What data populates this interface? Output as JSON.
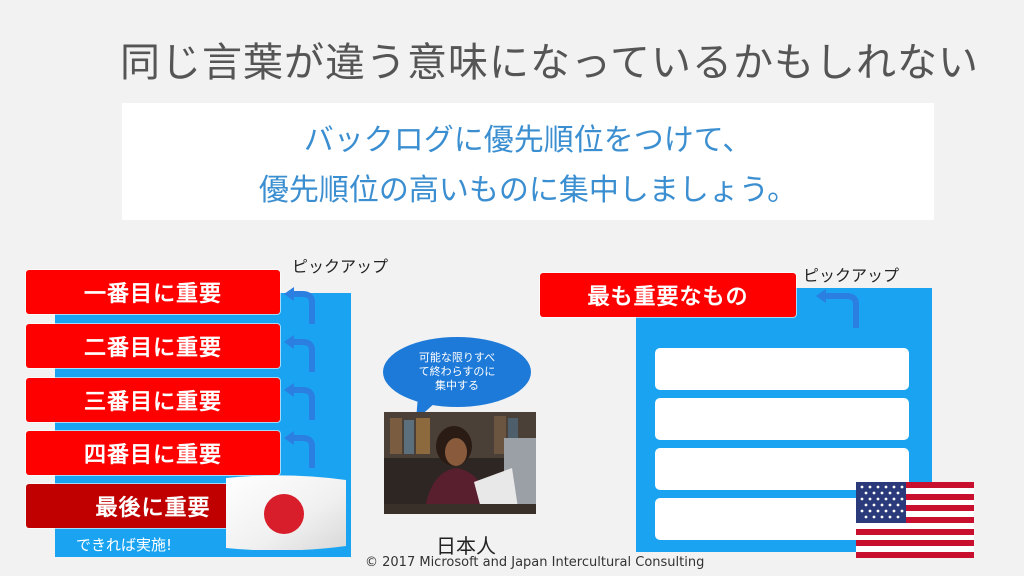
{
  "slide": {
    "title": "同じ言葉が違う意味になっているかもしれない",
    "banner": {
      "line1": "バックログに優先順位をつけて、",
      "line2": "優先順位の高いものに集中しましょう。"
    },
    "left": {
      "pickup": "ピックアップ",
      "bars": [
        "一番目に重要",
        "二番目に重要",
        "三番目に重要",
        "四番目に重要",
        "最後に重要"
      ],
      "note": "できれば実施!"
    },
    "middle": {
      "bubble_lines": [
        "可能な限りすべ",
        "て終わらすのに",
        "集中する"
      ],
      "caption": "日本人"
    },
    "right": {
      "pickup": "ピックアップ",
      "bar": "最も重要なもの",
      "row_count": 4
    },
    "footer": {
      "copyright": "© 2017 Microsoft and Japan Intercultural Consulting"
    },
    "colors": {
      "red": "#ff0000",
      "dark_red": "#c00000",
      "blue_panel": "#1aa3f0",
      "arrow_blue": "#2b7fe0",
      "banner_text": "#3b8fd1"
    },
    "icons": {
      "japan_flag": "japan-flag-icon",
      "usa_flag": "usa-flag-icon",
      "speech_bubble": "speech-bubble-icon",
      "photo": "tired-person-photo"
    }
  }
}
